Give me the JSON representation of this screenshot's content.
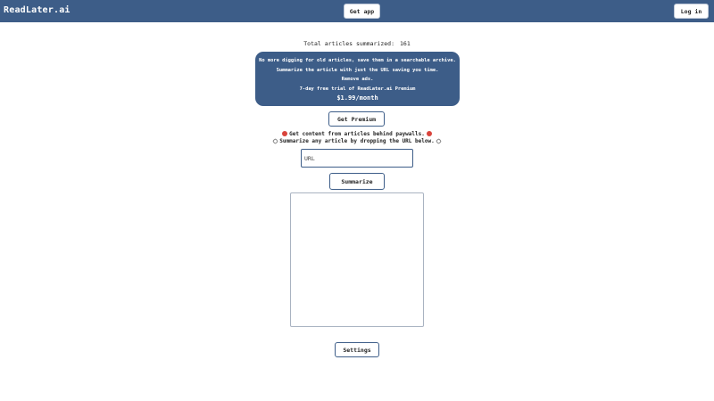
{
  "header": {
    "brand": "ReadLater.ai",
    "get_app_label": "Get app",
    "login_label": "Log in",
    "background_color": "#3d5d88"
  },
  "stats": {
    "label": "Total articles summarized:",
    "count": "161"
  },
  "promo": {
    "lines": [
      "No more digging for old articles, save them in a searchable archive.",
      "Summarize the article with just the URL saving you time.",
      "Remove ads.",
      "7-day free trial of ReadLater.ai Premium"
    ],
    "price": "$1.99/month",
    "background_color": "#3d5d88"
  },
  "premium_button_label": "Get Premium",
  "notices": {
    "paywall": "Get content from articles behind paywalls.",
    "paywall_icon": "red-circle-icon",
    "summarize": "Summarize any article by dropping the URL below.",
    "summarize_icon": "paperclip-icon"
  },
  "url_input": {
    "placeholder": "URL",
    "value": ""
  },
  "summarize_button_label": "Summarize",
  "summary_output": {
    "value": ""
  },
  "settings_button_label": "Settings"
}
